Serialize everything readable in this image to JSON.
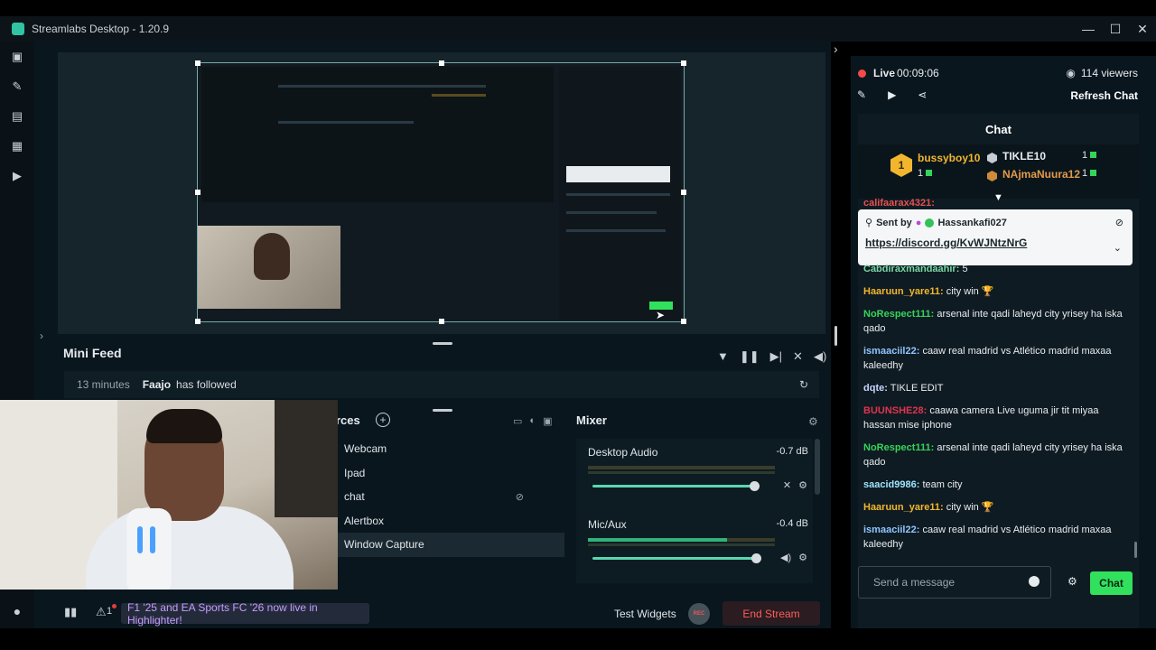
{
  "app": {
    "title": "Streamlabs Desktop - 1.20.9"
  },
  "window_controls": [
    "—",
    "☐",
    "✕"
  ],
  "mini_feed": {
    "title": "Mini Feed",
    "event": {
      "time": "13 minutes",
      "user": "Faajo",
      "action": "has followed"
    }
  },
  "sources": {
    "title": "rces",
    "items": [
      "Webcam",
      "Ipad",
      "chat",
      "Alertbox",
      "Window Capture"
    ]
  },
  "mixer": {
    "title": "Mixer",
    "channels": [
      {
        "name": "Desktop Audio",
        "db": "-0.7 dB",
        "level": 1.0
      },
      {
        "name": "Mic/Aux",
        "db": "-0.4 dB",
        "level": 0.72
      }
    ]
  },
  "bottombar": {
    "notif_count": "1",
    "banner": "F1 '25 and EA Sports FC '26 now live in Highlighter!",
    "test_widgets": "Test Widgets",
    "rec": "REC",
    "end_stream": "End Stream"
  },
  "stream": {
    "live_label": "Live",
    "elapsed": "00:09:06",
    "viewers": "114 viewers",
    "refresh_chat": "Refresh Chat"
  },
  "chat": {
    "title": "Chat",
    "podium": {
      "first": {
        "name": "bussyboy10",
        "count": "1"
      },
      "second": {
        "name": "TIKLE10",
        "count": "1"
      },
      "third": {
        "name": "NAjmaNuura12",
        "count": "1"
      }
    },
    "pinned": {
      "sent_by": "Sent by",
      "user": "Hassankafi027",
      "link": "https://discord.gg/KvWJNtzNrG"
    },
    "partial_top": "califaarax4321:",
    "partial_user": "Cabdiraxmandaahir:",
    "partial_text": "5",
    "messages": [
      {
        "user": "Haaruun_yare11:",
        "text": "city win 🏆",
        "color": "#f1b62e"
      },
      {
        "user": "NoRespect111:",
        "text": "arsenal inte qadi laheyd city yrisey ha iska qado",
        "color": "#35d45a"
      },
      {
        "user": "ismaaciil22:",
        "text": "caaw real madrid vs Atlético madrid maxaa kaleedhy",
        "color": "#8fc6ff"
      },
      {
        "user": "dqte:",
        "text": "TIKLE EDIT",
        "color": "#c7d3ff"
      },
      {
        "user": "BUUNSHE28:",
        "text": "caawa camera Live uguma jir tit miyaa hassan mise iphone",
        "color": "#e0334f"
      },
      {
        "user": "NoRespect111:",
        "text": "arsenal inte qadi laheyd city yrisey ha iska qado",
        "color": "#35d45a"
      },
      {
        "user": "saacid9986:",
        "text": "team city",
        "color": "#9fe3ff"
      },
      {
        "user": "Haaruun_yare11:",
        "text": "city win 🏆",
        "color": "#f1b62e"
      },
      {
        "user": "ismaaciil22:",
        "text": "caaw real madrid vs Atlético madrid maxaa kaleedhy",
        "color": "#8fc6ff"
      }
    ],
    "input_placeholder": "Send a message",
    "send_label": "Chat"
  },
  "colors": {
    "accent": "#31e15d",
    "live": "#f24a4a",
    "end_stream": "#ff5d5d",
    "banner_text": "#c59cff"
  }
}
